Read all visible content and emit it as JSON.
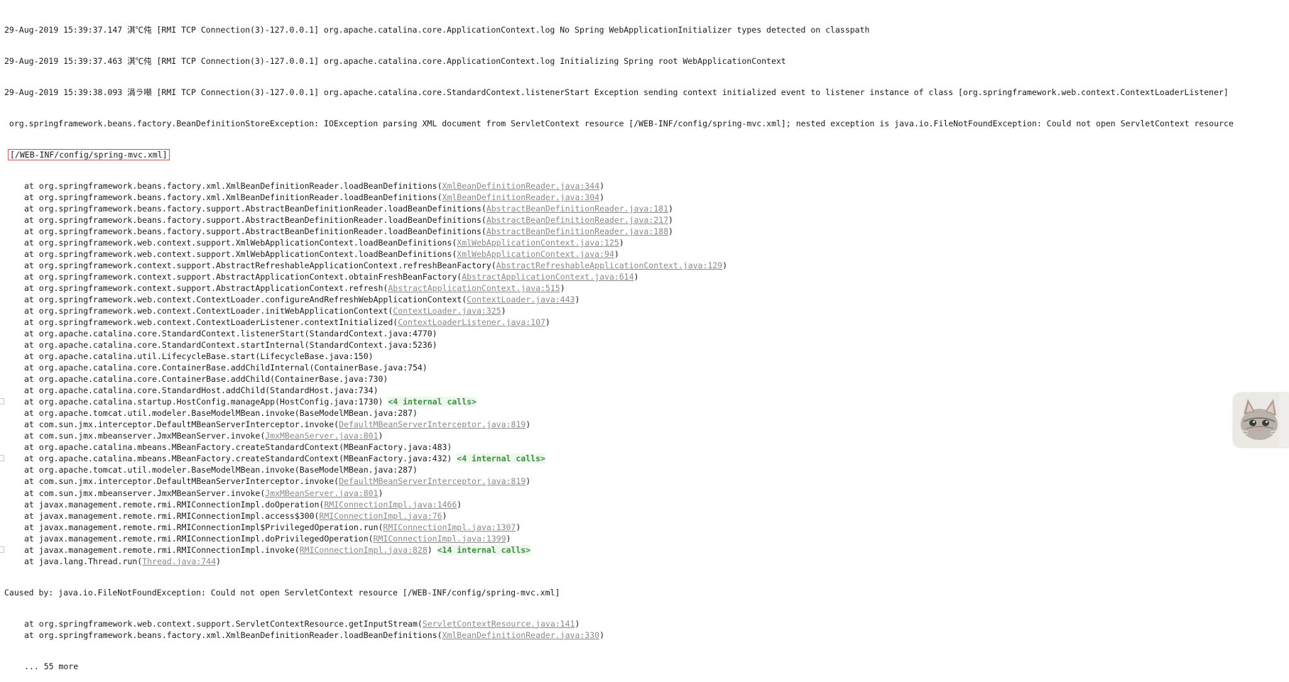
{
  "console": {
    "header_lines": [
      "29-Aug-2019 15:39:37.147 淇℃伅 [RMI TCP Connection(3)-127.0.0.1] org.apache.catalina.core.ApplicationContext.log No Spring WebApplicationInitializer types detected on classpath",
      "29-Aug-2019 15:39:37.463 淇℃伅 [RMI TCP Connection(3)-127.0.0.1] org.apache.catalina.core.ApplicationContext.log Initializing Spring root WebApplicationContext",
      "29-Aug-2019 15:39:38.093 涓ラ噸 [RMI TCP Connection(3)-127.0.0.1] org.apache.catalina.core.StandardContext.listenerStart Exception sending context initialized event to listener instance of class [org.springframework.web.context.ContextLoaderListener]"
    ],
    "exception_line": " org.springframework.beans.factory.BeanDefinitionStoreException: IOException parsing XML document from ServletContext resource [/WEB-INF/config/spring-mvc.xml]; nested exception is java.io.FileNotFoundException: Could not open ServletContext resource",
    "exception_cont": "[/WEB-INF/config/spring-mvc.xml]",
    "stack": [
      {
        "text": "at org.springframework.beans.factory.xml.XmlBeanDefinitionReader.loadBeanDefinitions(",
        "link": "XmlBeanDefinitionReader.java:344",
        "tail": ")"
      },
      {
        "text": "at org.springframework.beans.factory.xml.XmlBeanDefinitionReader.loadBeanDefinitions(",
        "link": "XmlBeanDefinitionReader.java:304",
        "tail": ")"
      },
      {
        "text": "at org.springframework.beans.factory.support.AbstractBeanDefinitionReader.loadBeanDefinitions(",
        "link": "AbstractBeanDefinitionReader.java:181",
        "tail": ")"
      },
      {
        "text": "at org.springframework.beans.factory.support.AbstractBeanDefinitionReader.loadBeanDefinitions(",
        "link": "AbstractBeanDefinitionReader.java:217",
        "tail": ")"
      },
      {
        "text": "at org.springframework.beans.factory.support.AbstractBeanDefinitionReader.loadBeanDefinitions(",
        "link": "AbstractBeanDefinitionReader.java:188",
        "tail": ")"
      },
      {
        "text": "at org.springframework.web.context.support.XmlWebApplicationContext.loadBeanDefinitions(",
        "link": "XmlWebApplicationContext.java:125",
        "tail": ")"
      },
      {
        "text": "at org.springframework.web.context.support.XmlWebApplicationContext.loadBeanDefinitions(",
        "link": "XmlWebApplicationContext.java:94",
        "tail": ")"
      },
      {
        "text": "at org.springframework.context.support.AbstractRefreshableApplicationContext.refreshBeanFactory(",
        "link": "AbstractRefreshableApplicationContext.java:129",
        "tail": ")"
      },
      {
        "text": "at org.springframework.context.support.AbstractApplicationContext.obtainFreshBeanFactory(",
        "link": "AbstractApplicationContext.java:614",
        "tail": ")"
      },
      {
        "text": "at org.springframework.context.support.AbstractApplicationContext.refresh(",
        "link": "AbstractApplicationContext.java:515",
        "tail": ")"
      },
      {
        "text": "at org.springframework.web.context.ContextLoader.configureAndRefreshWebApplicationContext(",
        "link": "ContextLoader.java:443",
        "tail": ")"
      },
      {
        "text": "at org.springframework.web.context.ContextLoader.initWebApplicationContext(",
        "link": "ContextLoader.java:325",
        "tail": ")"
      },
      {
        "text": "at org.springframework.web.context.ContextLoaderListener.contextInitialized(",
        "link": "ContextLoaderListener.java:107",
        "tail": ")"
      },
      {
        "text": "at org.apache.catalina.core.StandardContext.listenerStart(StandardContext.java:4770)"
      },
      {
        "text": "at org.apache.catalina.core.StandardContext.startInternal(StandardContext.java:5236)"
      },
      {
        "text": "at org.apache.catalina.util.LifecycleBase.start(LifecycleBase.java:150)"
      },
      {
        "text": "at org.apache.catalina.core.ContainerBase.addChildInternal(ContainerBase.java:754)"
      },
      {
        "text": "at org.apache.catalina.core.ContainerBase.addChild(ContainerBase.java:730)"
      },
      {
        "text": "at org.apache.catalina.core.StandardHost.addChild(StandardHost.java:734)"
      },
      {
        "text": "at org.apache.catalina.startup.HostConfig.manageApp(HostConfig.java:1730) ",
        "internal": "<4 internal calls>",
        "fold": true
      },
      {
        "text": "at org.apache.tomcat.util.modeler.BaseModelMBean.invoke(BaseModelMBean.java:287)"
      },
      {
        "text": "at com.sun.jmx.interceptor.DefaultMBeanServerInterceptor.invoke(",
        "link": "DefaultMBeanServerInterceptor.java:819",
        "tail": ")"
      },
      {
        "text": "at com.sun.jmx.mbeanserver.JmxMBeanServer.invoke(",
        "link": "JmxMBeanServer.java:801",
        "tail": ")"
      },
      {
        "text": "at org.apache.catalina.mbeans.MBeanFactory.createStandardContext(MBeanFactory.java:483)"
      },
      {
        "text": "at org.apache.catalina.mbeans.MBeanFactory.createStandardContext(MBeanFactory.java:432) ",
        "internal": "<4 internal calls>",
        "fold": true
      },
      {
        "text": "at org.apache.tomcat.util.modeler.BaseModelMBean.invoke(BaseModelMBean.java:287)"
      },
      {
        "text": "at com.sun.jmx.interceptor.DefaultMBeanServerInterceptor.invoke(",
        "link": "DefaultMBeanServerInterceptor.java:819",
        "tail": ")"
      },
      {
        "text": "at com.sun.jmx.mbeanserver.JmxMBeanServer.invoke(",
        "link": "JmxMBeanServer.java:801",
        "tail": ")"
      },
      {
        "text": "at javax.management.remote.rmi.RMIConnectionImpl.doOperation(",
        "link": "RMIConnectionImpl.java:1466",
        "tail": ")"
      },
      {
        "text": "at javax.management.remote.rmi.RMIConnectionImpl.access$300(",
        "link": "RMIConnectionImpl.java:76",
        "tail": ")"
      },
      {
        "text": "at javax.management.remote.rmi.RMIConnectionImpl$PrivilegedOperation.run(",
        "link": "RMIConnectionImpl.java:1307",
        "tail": ")"
      },
      {
        "text": "at javax.management.remote.rmi.RMIConnectionImpl.doPrivilegedOperation(",
        "link": "RMIConnectionImpl.java:1399",
        "tail": ")"
      },
      {
        "text": "at javax.management.remote.rmi.RMIConnectionImpl.invoke(",
        "link": "RMIConnectionImpl.java:828",
        "tail": ") ",
        "internal": "<14 internal calls>",
        "fold": true
      },
      {
        "text": "at java.lang.Thread.run(",
        "link": "Thread.java:744",
        "tail": ")"
      }
    ],
    "caused_by": "Caused by: java.io.FileNotFoundException: Could not open ServletContext resource [/WEB-INF/config/spring-mvc.xml]",
    "caused_stack": [
      {
        "text": "at org.springframework.web.context.support.ServletContextResource.getInputStream(",
        "link": "ServletContextResource.java:141",
        "tail": ")"
      },
      {
        "text": "at org.springframework.beans.factory.xml.XmlBeanDefinitionReader.loadBeanDefinitions(",
        "link": "XmlBeanDefinitionReader.java:330",
        "tail": ")"
      }
    ],
    "more": "... 55 more"
  },
  "colors": {
    "link": "#8a8a8a",
    "internal_calls": "#3f8f3f",
    "highlight_box": "#e05050"
  },
  "avatar": {
    "icon": "kitten-avatar-icon"
  }
}
